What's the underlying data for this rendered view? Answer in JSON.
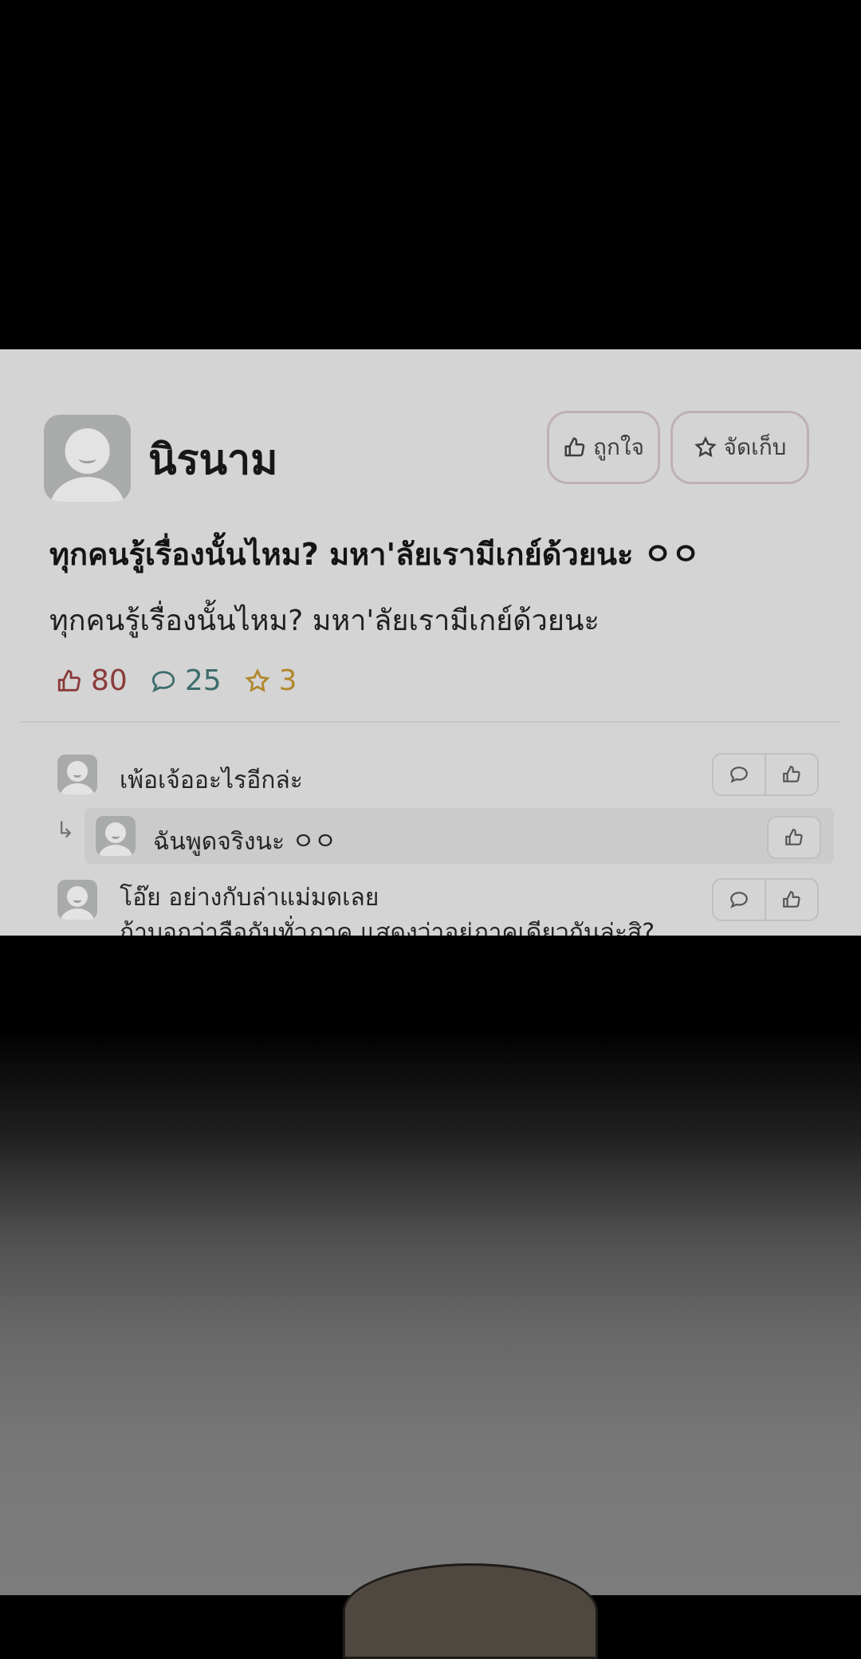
{
  "post": {
    "author": "นิรนาม",
    "like_button_label": "ถูกใจ",
    "save_button_label": "จัดเก็บ",
    "title": "ทุกคนรู้เรื่องนั้นไหม? มหา'ลัยเรามีเกย์ด้วยนะ ㅇㅇ",
    "body": "ทุกคนรู้เรื่องนั้นไหม? มหา'ลัยเรามีเกย์ด้วยนะ",
    "like_count": "80",
    "comment_count": "25",
    "save_count": "3"
  },
  "comments": [
    {
      "text": "เพ้อเจ้ออะไรอีกล่ะ"
    },
    {
      "text": "ฉันพูดจริงนะ ㅇㅇ",
      "reply": true
    },
    {
      "text": "โอ๊ย อย่างกับล่าแม่มดเลย",
      "text_line2": "ถ้าบอกว่าลือกันทั่วภาค แสดงว่าอยู่ภาคเดียวกันล่ะสิ?"
    }
  ],
  "colors": {
    "card_background": "#d4d4d4",
    "like_color": "#8a3a3a",
    "comment_color": "#3d6d6d",
    "star_color": "#b0882d"
  },
  "icons": [
    "thumbs-up-icon",
    "star-icon",
    "speech-bubble-icon",
    "reply-arrow-icon",
    "avatar-icon"
  ]
}
